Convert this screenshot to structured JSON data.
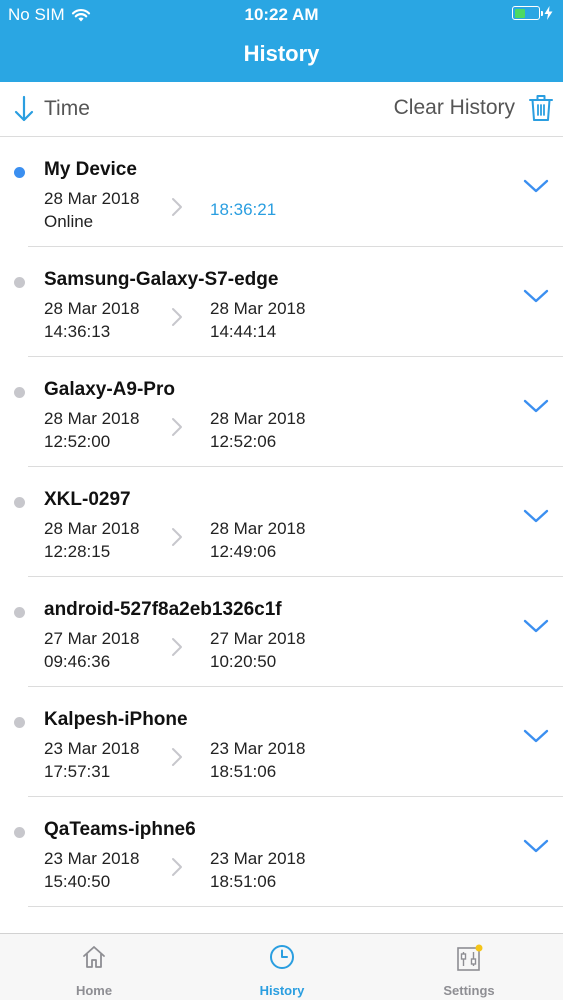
{
  "status_bar": {
    "carrier": "No SIM",
    "time": "10:22 AM"
  },
  "nav": {
    "title": "History"
  },
  "toolbar": {
    "sort_label": "Time",
    "clear_label": "Clear History"
  },
  "colors": {
    "header_bg": "#2aa6e3",
    "accent": "#2a9ee0",
    "active_dot": "#3b8ff0",
    "inactive_dot": "#c7c7cc",
    "battery": "#4cd964"
  },
  "devices": [
    {
      "name": "My Device",
      "start_date": "28 Mar 2018",
      "start_sub": "Online",
      "end_date": "",
      "end_sub": "",
      "end_live": "18:36:21",
      "active": true
    },
    {
      "name": "Samsung-Galaxy-S7-edge",
      "start_date": "28 Mar 2018",
      "start_sub": "14:36:13",
      "end_date": "28 Mar 2018",
      "end_sub": "14:44:14",
      "end_live": ""
    },
    {
      "name": "Galaxy-A9-Pro",
      "start_date": "28 Mar 2018",
      "start_sub": "12:52:00",
      "end_date": "28 Mar 2018",
      "end_sub": "12:52:06",
      "end_live": ""
    },
    {
      "name": "XKL-0297",
      "start_date": "28 Mar 2018",
      "start_sub": "12:28:15",
      "end_date": "28 Mar 2018",
      "end_sub": "12:49:06",
      "end_live": ""
    },
    {
      "name": "android-527f8a2eb1326c1f",
      "start_date": "27 Mar 2018",
      "start_sub": "09:46:36",
      "end_date": "27 Mar 2018",
      "end_sub": "10:20:50",
      "end_live": ""
    },
    {
      "name": "Kalpesh-iPhone",
      "start_date": "23 Mar 2018",
      "start_sub": "17:57:31",
      "end_date": "23 Mar 2018",
      "end_sub": "18:51:06",
      "end_live": ""
    },
    {
      "name": "QaTeams-iphne6",
      "start_date": "23 Mar 2018",
      "start_sub": "15:40:50",
      "end_date": "23 Mar 2018",
      "end_sub": "18:51:06",
      "end_live": ""
    }
  ],
  "tabs": [
    {
      "label": "Home",
      "icon": "home-icon"
    },
    {
      "label": "History",
      "icon": "clock-icon",
      "active": true
    },
    {
      "label": "Settings",
      "icon": "settings-icon",
      "badge": true
    }
  ]
}
